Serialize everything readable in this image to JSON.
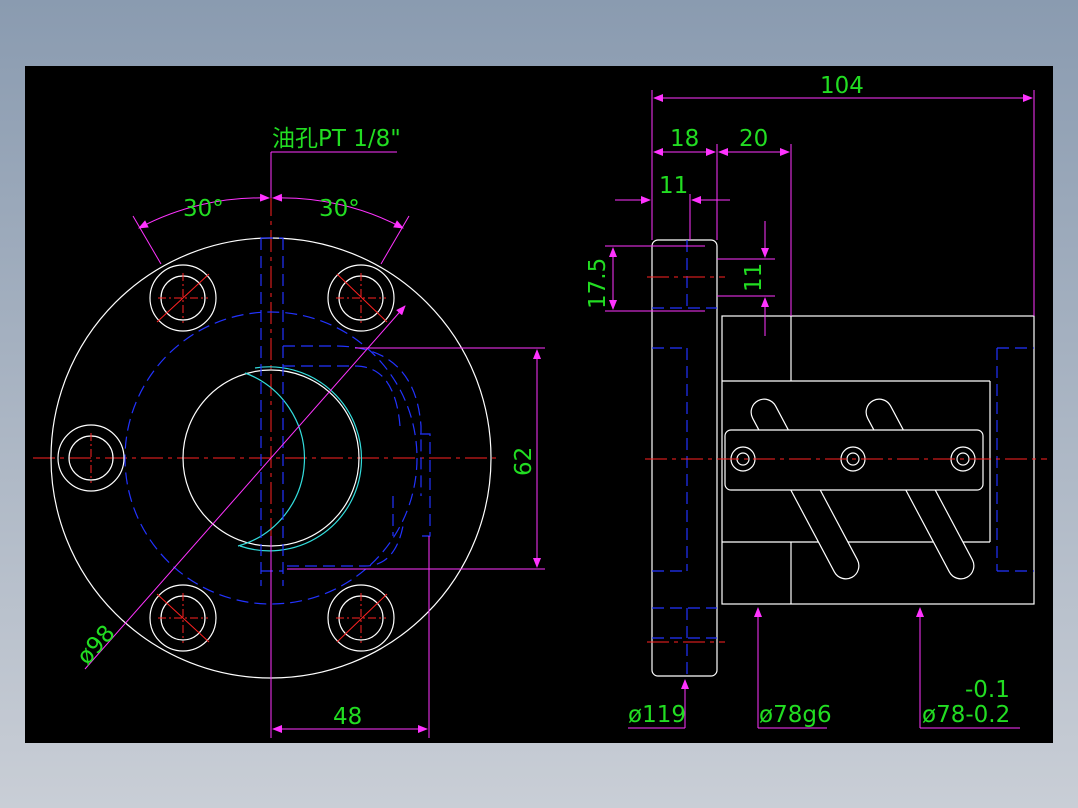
{
  "colors": {
    "background": "#000000",
    "outline": "#ffffff",
    "hidden": "#2233ff",
    "center": "#ff2222",
    "dimension": "#ff33ff",
    "text": "#22dd22",
    "thread": "#33dddd"
  },
  "front_view": {
    "oil_hole_label": "油孔PT 1/8\"",
    "angle_left": "30°",
    "angle_right": "30°",
    "dim_62": "62",
    "dim_48": "48",
    "dim_diameter_98": "ø98"
  },
  "side_view": {
    "dim_104": "104",
    "dim_18": "18",
    "dim_20": "20",
    "dim_11_top": "11",
    "dim_17_5": "17.5",
    "dim_11_right": "11",
    "dim_diameter_119": "ø119",
    "dim_diameter_78g6": "ø78g6",
    "dim_diameter_78": "ø78-0.2",
    "dim_tolerance_upper": "-0.1"
  }
}
